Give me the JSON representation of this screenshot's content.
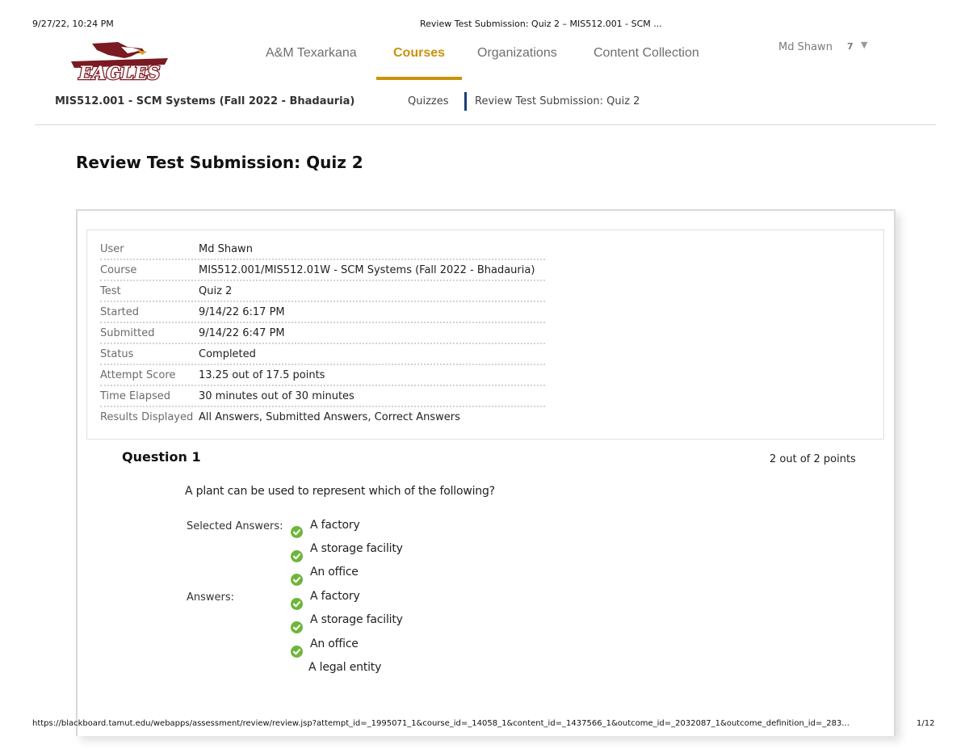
{
  "print_header": {
    "datetime": "9/27/22, 10:24 PM",
    "page_title": "Review Test Submission: Quiz 2 – MIS512.001 - SCM ..."
  },
  "print_footer": {
    "url": "https://blackboard.tamut.edu/webapps/assessment/review/review.jsp?attempt_id=_1995071_1&course_id=_14058_1&content_id=_1437566_1&outcome_id=_2032087_1&outcome_definition_id=_283...",
    "page_number": "1/12"
  },
  "logo": {
    "text": "EAGLES"
  },
  "top_nav": {
    "items": [
      {
        "label": "A&M Texarkana"
      },
      {
        "label": "Courses",
        "active": true
      },
      {
        "label": "Organizations"
      },
      {
        "label": "Content Collection"
      }
    ]
  },
  "user": {
    "name": "Md Shawn",
    "notification_count": "7"
  },
  "course_bar": {
    "course_title": "MIS512.001 - SCM Systems (Fall 2022 - Bhadauria)",
    "breadcrumbs": [
      "Quizzes",
      "Review Test Submission: Quiz 2"
    ]
  },
  "page_title": "Review Test Submission: Quiz 2",
  "details": [
    {
      "label": "User",
      "value": "Md Shawn"
    },
    {
      "label": "Course",
      "value": "MIS512.001/MIS512.01W - SCM Systems (Fall 2022 - Bhadauria)"
    },
    {
      "label": "Test",
      "value": "Quiz 2"
    },
    {
      "label": "Started",
      "value": "9/14/22 6:17 PM"
    },
    {
      "label": "Submitted",
      "value": "9/14/22 6:47 PM"
    },
    {
      "label": "Status",
      "value": "Completed"
    },
    {
      "label": "Attempt Score",
      "value": "13.25 out of 17.5 points"
    },
    {
      "label": "Time Elapsed",
      "value": "30 minutes out of 30 minutes"
    },
    {
      "label": "Results Displayed",
      "value": "All Answers, Submitted Answers, Correct Answers"
    }
  ],
  "question": {
    "title": "Question 1",
    "points": "2 out of 2 points",
    "text": "A plant can be used to represent which of the following?",
    "selected_label": "Selected Answers:",
    "selected_answers": [
      "A factory",
      "A storage facility",
      "An office"
    ],
    "answers_label": "Answers:",
    "answers": [
      {
        "text": "A factory",
        "correct": true
      },
      {
        "text": "A storage facility",
        "correct": true
      },
      {
        "text": "An office",
        "correct": true
      },
      {
        "text": "A legal entity",
        "correct": false
      }
    ]
  },
  "colors": {
    "accent": "#c8930b",
    "nav_text": "#6f6f6f",
    "breadcrumb_separator": "#1b3e76",
    "check": "#6eb63a"
  }
}
